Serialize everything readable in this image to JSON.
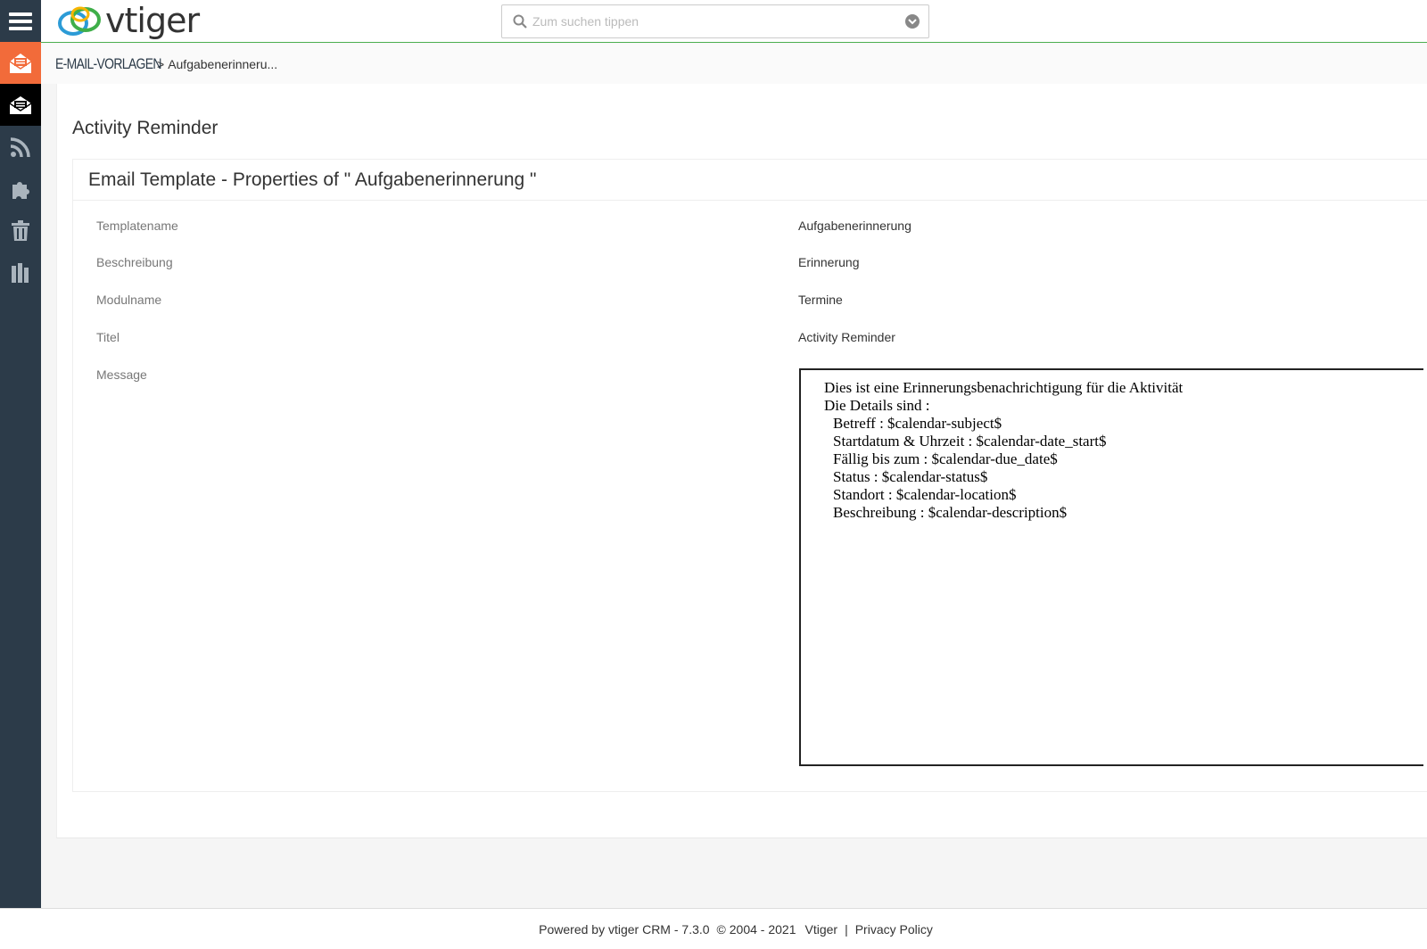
{
  "app": {
    "logo_text": "vtiger",
    "brand_colors": {
      "sidebar": "#2c3b49",
      "accent_orange": "#f26b3a",
      "topbar_border": "#4caf50"
    }
  },
  "search": {
    "placeholder": "Zum suchen tippen"
  },
  "sidebar": {
    "items": [
      {
        "icon": "hamburger-menu-icon"
      },
      {
        "icon": "email-templates-icon"
      },
      {
        "icon": "email-open-icon"
      },
      {
        "icon": "rss-icon"
      },
      {
        "icon": "puzzle-icon"
      },
      {
        "icon": "trash-icon"
      },
      {
        "icon": "books-icon"
      }
    ]
  },
  "breadcrumb": {
    "module": "E-Mail-Vorlagen",
    "separator": ">",
    "record": "Aufgabenerinneru..."
  },
  "page": {
    "title": "Activity Reminder"
  },
  "card": {
    "header": "Email Template - Properties of \" Aufgabenerinnerung \""
  },
  "fields": [
    {
      "label": "Templatename",
      "value": "Aufgabenerinnerung"
    },
    {
      "label": "Beschreibung",
      "value": "Erinnerung"
    },
    {
      "label": "Modulname",
      "value": "Termine"
    },
    {
      "label": "Titel",
      "value": "Activity Reminder"
    },
    {
      "label": "Message",
      "value": ""
    }
  ],
  "message": {
    "lines": [
      "Dies ist eine Erinnerungsbenachrichtigung für die Aktivität",
      "Die Details sind :",
      "Betreff : $calendar-subject$",
      "Startdatum & Uhrzeit : $calendar-date_start$",
      "Fällig bis zum : $calendar-due_date$",
      "Status : $calendar-status$",
      "Standort : $calendar-location$",
      "Beschreibung : $calendar-description$"
    ]
  },
  "footer": {
    "powered": "Powered by vtiger CRM - 7.3.0",
    "copyright": "© 2004 - 2021",
    "vtiger_link": "Vtiger",
    "separator": "|",
    "privacy_link": "Privacy Policy"
  }
}
